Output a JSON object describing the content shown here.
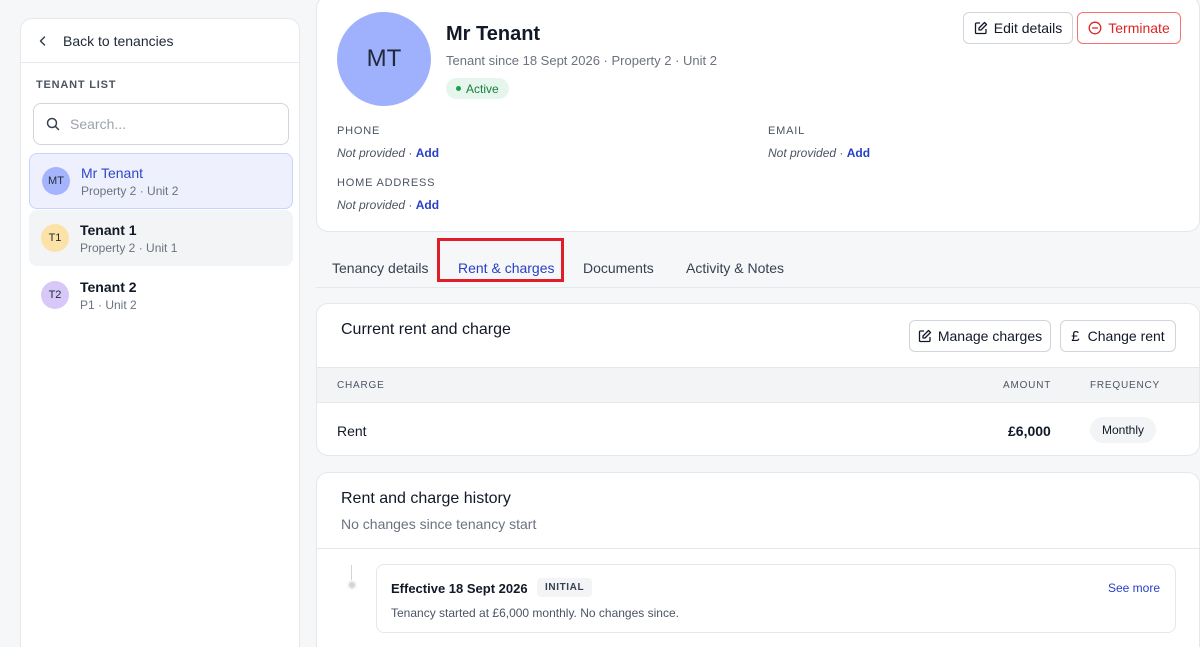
{
  "sidebar": {
    "back_label": "Back to tenancies",
    "list_heading": "TENANT LIST",
    "search_placeholder": "Search...",
    "tenants": [
      {
        "initials": "MT",
        "name": "Mr Tenant",
        "unit": "Property 2 · Unit 2",
        "avatar_color": "#a5b4fc",
        "state": "selected"
      },
      {
        "initials": "T1",
        "name": "Tenant 1",
        "unit": "Property 2 · Unit 1",
        "avatar_color": "#fde2a7",
        "state": "hovered"
      },
      {
        "initials": "T2",
        "name": "Tenant 2",
        "unit": "P1 · Unit 2",
        "avatar_color": "#d8c8f7",
        "state": "default"
      }
    ]
  },
  "profile": {
    "initials": "MT",
    "name": "Mr Tenant",
    "meta": "Tenant since 18 Sept 2026 · Property 2 · Unit 2",
    "status": "Active",
    "edit_label": "Edit details",
    "terminate_label": "Terminate",
    "phone": {
      "label": "PHONE",
      "value": "Not provided",
      "action": "Add"
    },
    "email": {
      "label": "EMAIL",
      "value": "Not provided",
      "action": "Add"
    },
    "address": {
      "label": "HOME ADDRESS",
      "value": "Not provided",
      "action": "Add"
    }
  },
  "tabs": [
    {
      "label": "Tenancy details",
      "active": false
    },
    {
      "label": "Rent & charges",
      "active": true
    },
    {
      "label": "Documents",
      "active": false
    },
    {
      "label": "Activity & Notes",
      "active": false
    }
  ],
  "current_rent": {
    "title": "Current rent and charge",
    "manage_label": "Manage charges",
    "change_rent_label": "Change rent",
    "columns": {
      "charge": "CHARGE",
      "amount": "AMOUNT",
      "frequency": "FREQUENCY"
    },
    "rows": [
      {
        "charge": "Rent",
        "amount": "£6,000",
        "frequency": "Monthly"
      }
    ]
  },
  "history": {
    "title": "Rent and charge history",
    "subtitle": "No changes since tenancy start",
    "entries": [
      {
        "title": "Effective 18 Sept 2026",
        "badge": "INITIAL",
        "description": "Tenancy started at £6,000 monthly. No changes since.",
        "link": "See more"
      }
    ]
  },
  "colors": {
    "accent": "#2740c5",
    "danger": "#dc2626",
    "success": "#15803d",
    "highlight_box": "#e11d2a"
  }
}
